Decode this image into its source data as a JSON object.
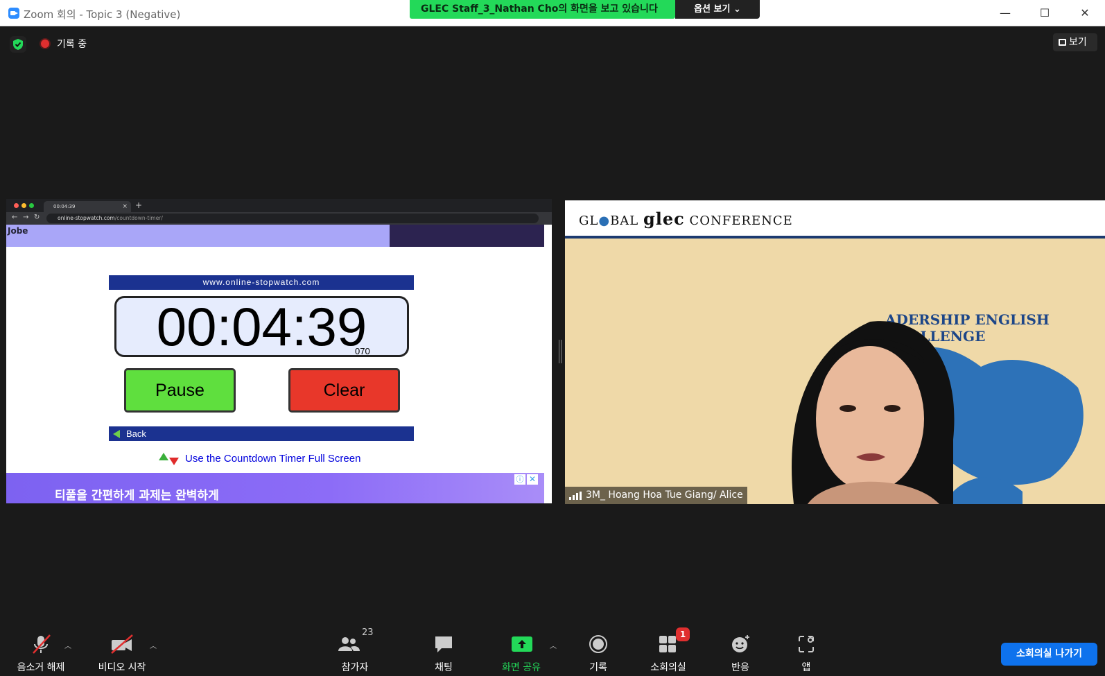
{
  "window": {
    "title": "Zoom 회의 - Topic 3 (Negative)",
    "minimize": "—",
    "maximize": "☐",
    "close": "✕"
  },
  "share_banner": {
    "text": "GLEC Staff_3_Nathan Cho의 화면을 보고 있습니다",
    "options_label": "옵션 보기 ⌄"
  },
  "top": {
    "recording_label": "기록 중",
    "view_label": "보기"
  },
  "shared_screen": {
    "tab_title": "00:04:39",
    "url_host": "online-stopwatch.com",
    "url_path": "/countdown-timer/",
    "ad_top_text": "Jobe",
    "site_name": "www.online-stopwatch.com",
    "timer_value": "00:04:39",
    "timer_ms": "070",
    "pause_label": "Pause",
    "clear_label": "Clear",
    "back_label": "Back",
    "fullscreen_link": "Use the Countdown Timer Full Screen",
    "ad_bottom_text": "티풀을 간편하게 과제는 완벽하게"
  },
  "participant": {
    "logo_left": "GL",
    "logo_mid": "BAL",
    "logo_brand": "glec",
    "logo_right": "CONFERENCE",
    "arc_text": "ADERSHIP ENGLISH CHALLENGE",
    "name": "3M_ Hoang Hoa Tue Giang/ Alice"
  },
  "toolbar": {
    "unmute_label": "음소거 해제",
    "video_label": "비디오 시작",
    "participants_label": "참가자",
    "participants_count": "23",
    "chat_label": "채팅",
    "share_label": "화면 공유",
    "record_label": "기록",
    "breakout_label": "소회의실",
    "breakout_badge": "1",
    "reactions_label": "반응",
    "apps_label": "앱",
    "leave_breakout_label": "소회의실 나가기"
  },
  "colors": {
    "banner_green": "#23d959",
    "share_green": "#23d959",
    "leave_blue": "#0e72ed",
    "badge_red": "#e02f2f"
  }
}
